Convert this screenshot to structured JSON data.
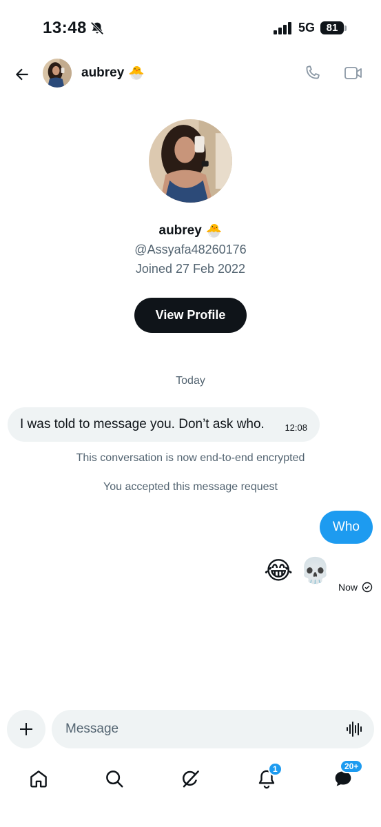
{
  "status_bar": {
    "time": "13:48",
    "network": "5G",
    "battery": "81"
  },
  "header": {
    "name": "aubrey",
    "name_emoji": "🐣"
  },
  "profile": {
    "name": "aubrey",
    "name_emoji": "🐣",
    "handle": "@Assyafa48260176",
    "joined": "Joined 27 Feb 2022",
    "view_profile_label": "View Profile"
  },
  "conversation": {
    "day_separator": "Today",
    "incoming": {
      "text": "I was told to message you. Don’t ask who.",
      "time": "12:08"
    },
    "system_messages": [
      "This conversation is now end-to-end encrypted",
      "You accepted this message request"
    ],
    "outgoing": {
      "text": "Who",
      "emojis": [
        "😂",
        "💀"
      ],
      "status": "Now"
    }
  },
  "composer": {
    "placeholder": "Message"
  },
  "bottom_nav": {
    "notifications_badge": "1",
    "messages_badge": "20+"
  },
  "colors": {
    "accent": "#1d9bf0",
    "text": "#0f1419",
    "secondary_text": "#536471",
    "bubble_gray": "#eff3f4"
  }
}
